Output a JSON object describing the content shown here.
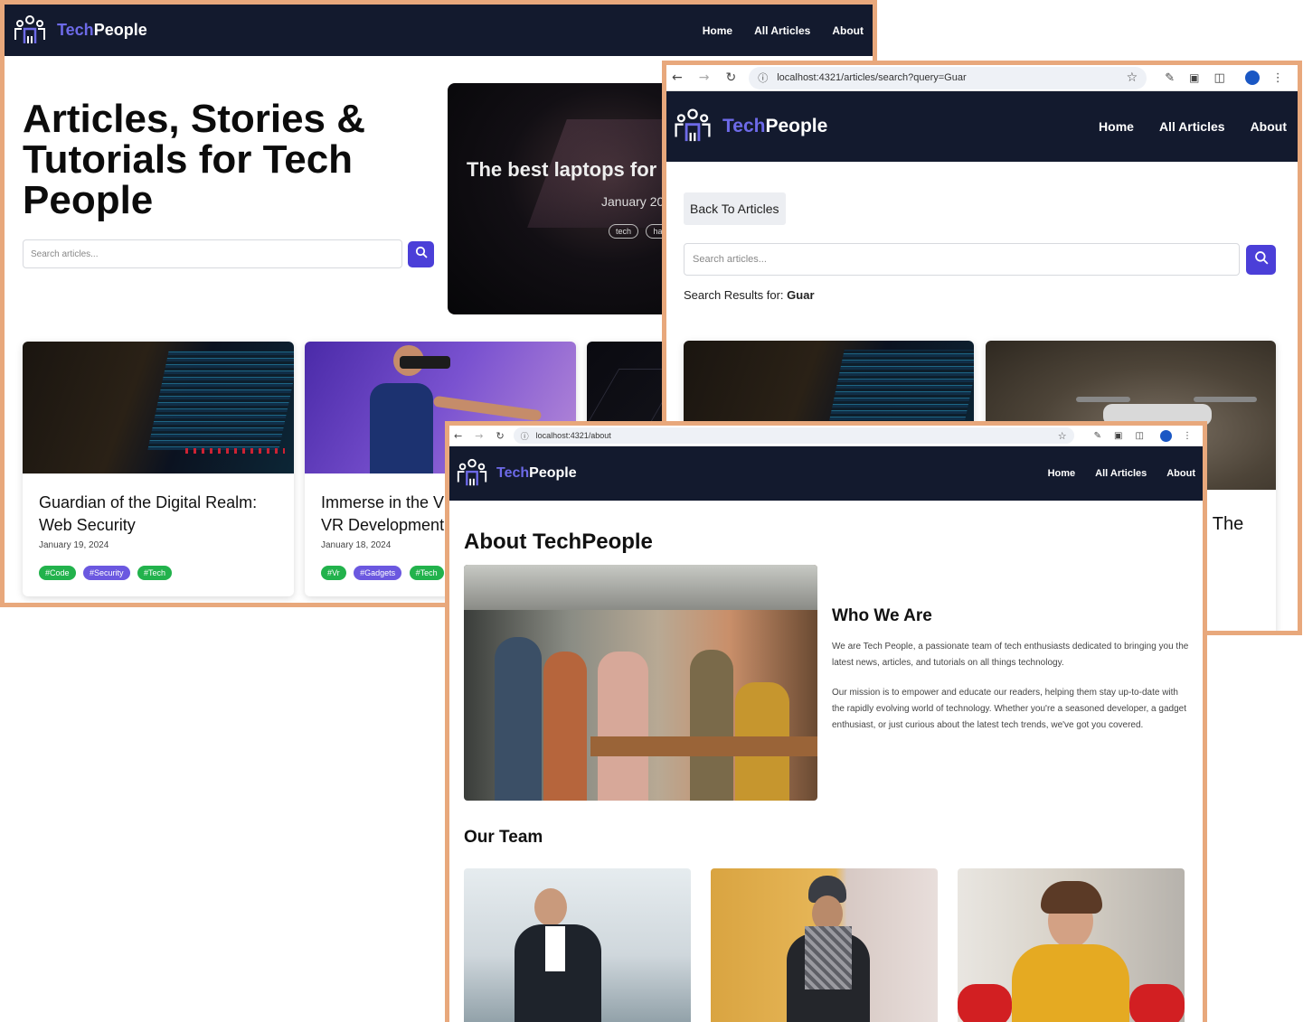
{
  "brand": {
    "tech": "Tech",
    "people": "People"
  },
  "nav": {
    "home": "Home",
    "all_articles": "All Articles",
    "about": "About"
  },
  "home": {
    "heading_lines": [
      "Articles, Stories &",
      "Tutorials for Tech",
      "People"
    ],
    "search_placeholder": "Search articles...",
    "hero": {
      "title": "The best laptops for",
      "date": "January 20",
      "tags": [
        "tech",
        "hard"
      ]
    },
    "cards": [
      {
        "title_lines": [
          "Guardian of the Digital Realm:",
          "Web Security"
        ],
        "date": "January 19, 2024",
        "tags": [
          {
            "label": "#Code",
            "color": "g"
          },
          {
            "label": "#Security",
            "color": "p"
          },
          {
            "label": "#Tech",
            "color": "g"
          }
        ]
      },
      {
        "title_lines": [
          "Immerse in the V",
          "VR Development"
        ],
        "date": "January 18, 2024",
        "tags": [
          {
            "label": "#Vr",
            "color": "g"
          },
          {
            "label": "#Gadgets",
            "color": "p"
          },
          {
            "label": "#Tech",
            "color": "g"
          }
        ]
      }
    ]
  },
  "search_page": {
    "url": "localhost:4321/articles/search?query=Guar",
    "back_label": "Back To Articles",
    "search_placeholder": "Search articles...",
    "results_prefix": "Search Results for: ",
    "results_query": "Guar",
    "partial_title": ": The"
  },
  "about_page": {
    "url": "localhost:4321/about",
    "title": "About TechPeople",
    "who_heading": "Who We Are",
    "who_p1": "We are Tech People, a passionate team of tech enthusiasts dedicated to bringing you the latest news, articles, and tutorials on all things technology.",
    "who_p2": "Our mission is to empower and educate our readers, helping them stay up-to-date with the rapidly evolving world of technology. Whether you're a seasoned developer, a gadget enthusiast, or just curious about the latest tech trends, we've got you covered.",
    "team_heading": "Our Team"
  },
  "colors": {
    "frame": "#e8a87c",
    "nav_bg": "#131a2e",
    "accent": "#4b3fd8",
    "brand_tech": "#6d6ae8",
    "tag_green": "#22b24c",
    "tag_purple": "#6b58e0"
  },
  "icons": [
    "logo-icon",
    "search-icon",
    "back-arrow-icon",
    "forward-arrow-icon",
    "reload-icon",
    "info-icon",
    "star-icon",
    "pen-icon",
    "extension-icon",
    "profile-icon",
    "menu-icon"
  ]
}
